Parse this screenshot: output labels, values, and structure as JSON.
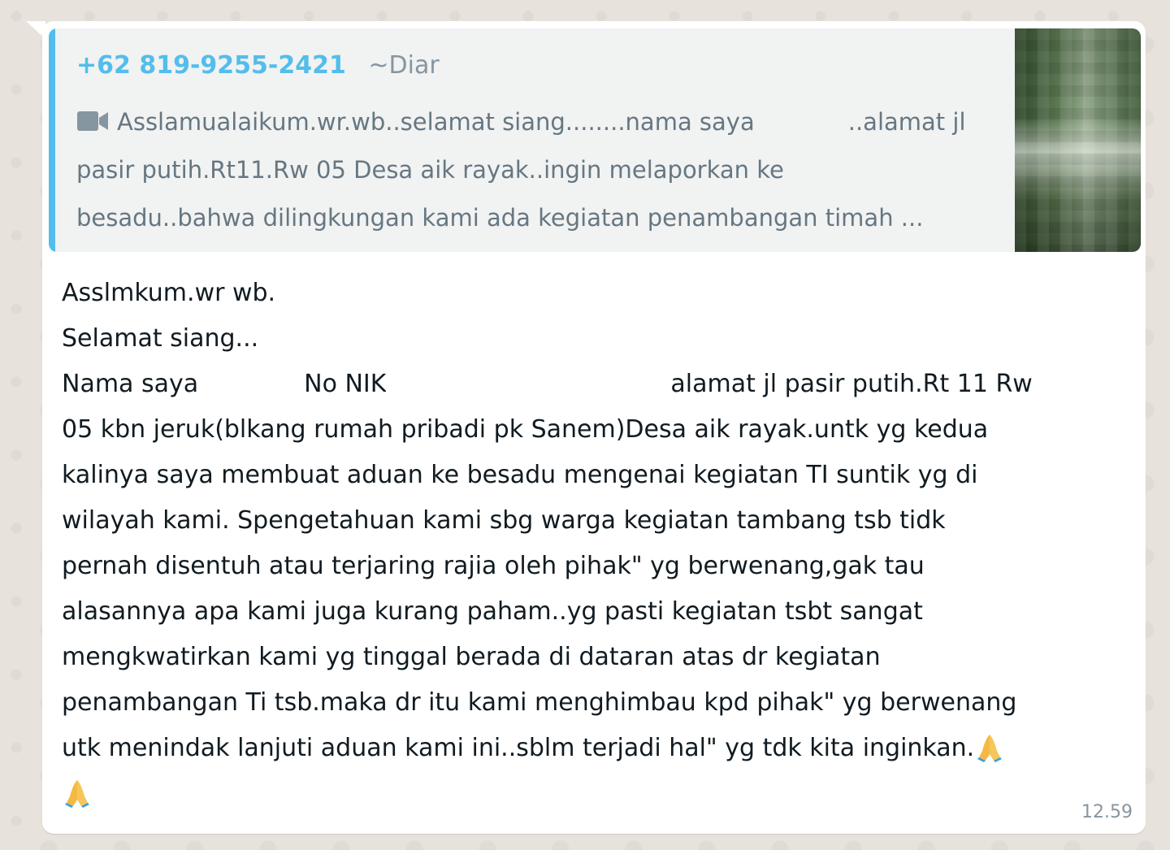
{
  "quoted_message": {
    "sender_phone": "+62 819-9255-2421",
    "sender_pushname": "~Diar",
    "media_icon": "video-camera-icon",
    "text_part1": "Asslamualaikum.wr.wb..selamat siang........nama saya",
    "text_part2": "..alamat jl pasir putih.Rt11.Rw 05 Desa aik rayak..ingin melaporkan ke besadu..bahwa dilingkungan kami ada kegiatan  penambangan timah ...",
    "accent_color": "#53bdeb"
  },
  "message": {
    "lines": {
      "l1": "Asslmkum.wr wb.",
      "l2": "Selamat siang...",
      "l3a": "Nama saya",
      "l3b": "No NIK",
      "l3c": "alamat jl pasir putih.Rt 11 Rw",
      "l4": "05 kbn jeruk(blkang rumah pribadi pk Sanem)Desa aik rayak.untk yg kedua",
      "l5": "kalinya saya membuat aduan ke besadu mengenai kegiatan TI suntik yg di",
      "l6": "wilayah kami. Spengetahuan kami sbg warga kegiatan tambang tsb tidk",
      "l7": "pernah disentuh atau terjaring rajia oleh pihak\" yg berwenang,gak tau",
      "l8": "alasannya apa kami juga kurang paham..yg pasti kegiatan tsbt sangat",
      "l9": "mengkwatirkan kami yg tinggal berada  di dataran atas dr kegiatan",
      "l10": "penambangan Ti tsb.maka dr itu kami menghimbau kpd pihak\" yg berwenang",
      "l11": "utk menindak lanjuti aduan kami ini..sblm terjadi hal\" yg tdk kita inginkan."
    },
    "emoji_icon": "folded-hands-emoji",
    "time": "12.59"
  }
}
